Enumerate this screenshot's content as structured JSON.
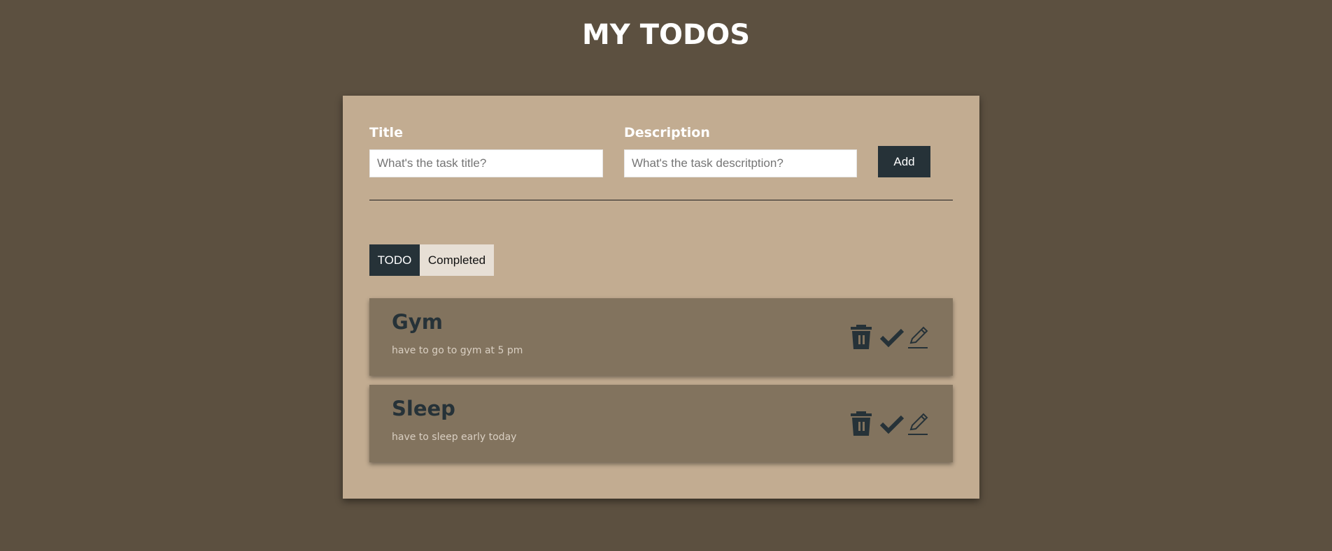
{
  "header": {
    "title": "MY TODOS"
  },
  "form": {
    "title_label": "Title",
    "title_placeholder": "What's the task title?",
    "title_value": "",
    "description_label": "Description",
    "description_placeholder": "What's the task descritption?",
    "description_value": "",
    "add_label": "Add"
  },
  "tabs": [
    {
      "label": "TODO",
      "active": true
    },
    {
      "label": "Completed",
      "active": false
    }
  ],
  "todos": [
    {
      "title": "Gym",
      "description": "have to go to gym at 5 pm"
    },
    {
      "title": "Sleep",
      "description": "have to sleep early today"
    }
  ],
  "icons": [
    "trash-icon",
    "check-icon",
    "pencil-icon"
  ],
  "colors": {
    "background": "#5c5040",
    "card": "#c2ac91",
    "item": "#82735e",
    "accent": "#263238",
    "tab_inactive": "#e7dfd5"
  }
}
